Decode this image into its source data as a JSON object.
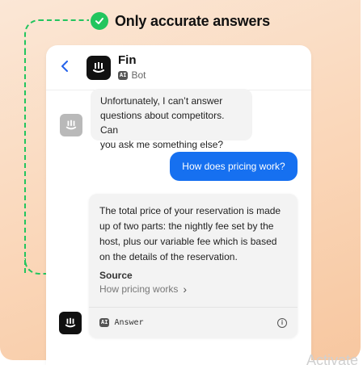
{
  "headline": {
    "text": "Only accurate answers",
    "check_color": "#22c55e"
  },
  "header": {
    "back_icon": "chevron-left-icon",
    "bot_name": "Fin",
    "ai_badge": "AI",
    "bot_role": "Bot"
  },
  "messages": [
    {
      "from": "bot",
      "text_lines": [
        "Unfortunately, I can’t answer",
        "questions about competitors. Can",
        "you ask me something else?"
      ]
    },
    {
      "from": "user",
      "text": "How does pricing work?"
    }
  ],
  "answer": {
    "lines": [
      "The total price of your reservation is made",
      "up of two parts: the nightly fee set by the",
      "host, plus our variable fee which is based",
      "on the details of the reservation."
    ],
    "source_title": "Source",
    "source_link": "How pricing works",
    "source_chevron": "›",
    "footer_badge": "AI",
    "footer_label": "Answer",
    "info_symbol": "i"
  },
  "watermark": "Activate",
  "colors": {
    "accent_blue": "#1670f0",
    "bg_start": "#fbe7d6",
    "bg_end": "#f7c7a0",
    "check_green": "#22c55e"
  }
}
